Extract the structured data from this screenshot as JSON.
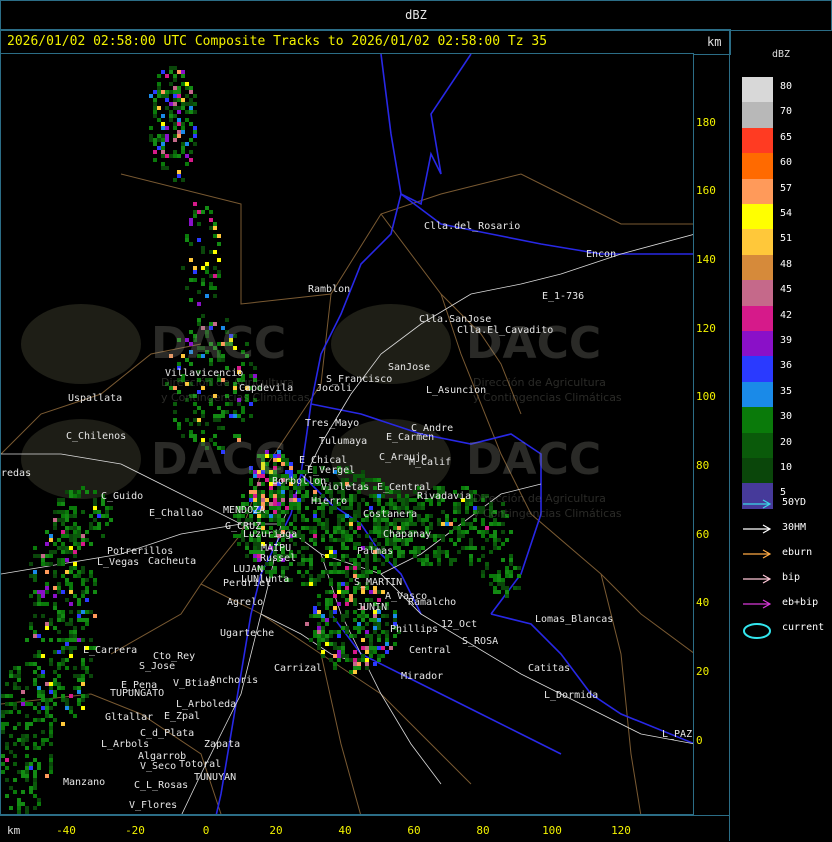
{
  "top_bar": {
    "title": "dBZ"
  },
  "header": {
    "title": "2026/01/02 02:58:00 UTC Composite Tracks to 2026/01/02 02:58:00 Tz 35",
    "km_label": "km"
  },
  "y_axis": {
    "ticks": [
      "180",
      "160",
      "140",
      "120",
      "100",
      "80",
      "60",
      "40",
      "20",
      "0"
    ]
  },
  "x_axis": {
    "km_label": "km",
    "ticks": [
      "-40",
      "-20",
      "0",
      "20",
      "40",
      "60",
      "80",
      "100",
      "120"
    ]
  },
  "legend": {
    "title": "dBZ",
    "levels": [
      {
        "label": "80",
        "color": "#d8d8d8"
      },
      {
        "label": "70",
        "color": "#b8b8b8"
      },
      {
        "label": "65",
        "color": "#ff3b22"
      },
      {
        "label": "60",
        "color": "#ff6a00"
      },
      {
        "label": "57",
        "color": "#ff9a5a"
      },
      {
        "label": "54",
        "color": "#ffff00"
      },
      {
        "label": "51",
        "color": "#ffc83a"
      },
      {
        "label": "48",
        "color": "#d68a3a"
      },
      {
        "label": "45",
        "color": "#c5698a"
      },
      {
        "label": "42",
        "color": "#d61a8a"
      },
      {
        "label": "39",
        "color": "#8a10c8"
      },
      {
        "label": "36",
        "color": "#2a3aff"
      },
      {
        "label": "35",
        "color": "#1a8ae8"
      },
      {
        "label": "30",
        "color": "#0a7a0a"
      },
      {
        "label": "20",
        "color": "#0a5a0a"
      },
      {
        "label": "10",
        "color": "#0a460a"
      },
      {
        "label": "5",
        "color": "#463a9a"
      }
    ],
    "tracks": [
      {
        "label": "50YD",
        "color": "#3ad8e8"
      },
      {
        "label": "30HM",
        "color": "#ffffff"
      },
      {
        "label": "eburn",
        "color": "#ffaa44"
      },
      {
        "label": "bip",
        "color": "#ffc8d8"
      },
      {
        "label": "eb+bip",
        "color": "#d838d8"
      },
      {
        "label": "current",
        "color": "#33e6ee"
      }
    ]
  },
  "watermark": {
    "logo_text": "DACC",
    "org_line1": "Dirección de Agricultura",
    "org_line2": "y Contingencias Climáticas"
  },
  "places": [
    {
      "name": "Clla.del_Rosario"
    },
    {
      "name": "Encon"
    },
    {
      "name": "Ramblon"
    },
    {
      "name": "E_1-736"
    },
    {
      "name": "Clla.SanJose"
    },
    {
      "name": "Clla.El_Cavadito"
    },
    {
      "name": "Villavicencio"
    },
    {
      "name": "S_Francisco"
    },
    {
      "name": "SanJose"
    },
    {
      "name": "Uspallata"
    },
    {
      "name": "Capdevila"
    },
    {
      "name": "Jocoli"
    },
    {
      "name": "L_Asuncion"
    },
    {
      "name": "Tres_Mayo"
    },
    {
      "name": "C_Andre"
    },
    {
      "name": "C_Chilenos"
    },
    {
      "name": "Tulumaya"
    },
    {
      "name": "E_Carmen"
    },
    {
      "name": "C_Araujo"
    },
    {
      "name": "E_Chical"
    },
    {
      "name": "M_Calif"
    },
    {
      "name": "redas"
    },
    {
      "name": "E_Vergel"
    },
    {
      "name": "Borbollon"
    },
    {
      "name": "Hierro"
    },
    {
      "name": "Violetas"
    },
    {
      "name": "E_Central"
    },
    {
      "name": "Rivadavia"
    },
    {
      "name": "C_Guido"
    },
    {
      "name": "E_Challao"
    },
    {
      "name": "MENDOZA"
    },
    {
      "name": "Costanera"
    },
    {
      "name": "G_CRUZ"
    },
    {
      "name": "Luzuriaga"
    },
    {
      "name": "Chapanay"
    },
    {
      "name": "Potrerillos"
    },
    {
      "name": "MAIPU"
    },
    {
      "name": "Palmas"
    },
    {
      "name": "Russel"
    },
    {
      "name": "L_Vegas"
    },
    {
      "name": "Cacheuta"
    },
    {
      "name": "LUJAN"
    },
    {
      "name": "LUNlunta"
    },
    {
      "name": "Perdriel"
    },
    {
      "name": "S_MARTIN"
    },
    {
      "name": "A_Vasco"
    },
    {
      "name": "Agrelo"
    },
    {
      "name": "Ramalcho"
    },
    {
      "name": "JUNIN"
    },
    {
      "name": "Ugarteche"
    },
    {
      "name": "Phillips"
    },
    {
      "name": "12_Oct"
    },
    {
      "name": "Lomas_Blancas"
    },
    {
      "name": "L_Carrera"
    },
    {
      "name": "Cto_Rey"
    },
    {
      "name": "S_Jose"
    },
    {
      "name": "Carrizal"
    },
    {
      "name": "S_ROSA"
    },
    {
      "name": "Central"
    },
    {
      "name": "Catitas"
    },
    {
      "name": "E_Pena"
    },
    {
      "name": "V_Btias"
    },
    {
      "name": "Anchoris"
    },
    {
      "name": "Mirador"
    },
    {
      "name": "TUPUNGATO"
    },
    {
      "name": "L_Dormida"
    },
    {
      "name": "L_Arboleda"
    },
    {
      "name": "Gltallar"
    },
    {
      "name": "E_Zpal"
    },
    {
      "name": "C_d_Plata"
    },
    {
      "name": "L_PAZ"
    },
    {
      "name": "L_Arbols"
    },
    {
      "name": "Zapata"
    },
    {
      "name": "Algarrob"
    },
    {
      "name": "V_Seco"
    },
    {
      "name": "Totoral"
    },
    {
      "name": "TUNUYAN"
    },
    {
      "name": "Manzano"
    },
    {
      "name": "C_L_Rosas"
    },
    {
      "name": "V_Flores"
    }
  ]
}
